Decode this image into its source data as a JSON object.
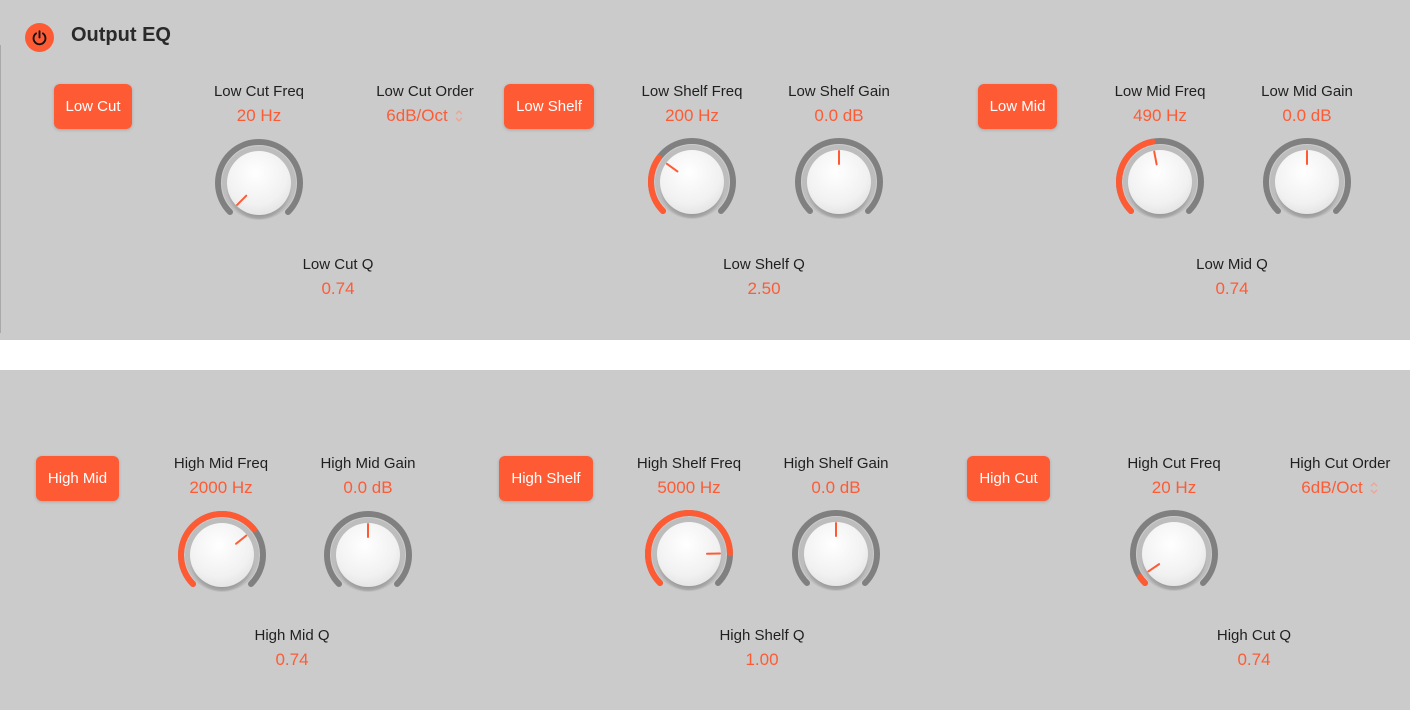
{
  "header": {
    "title": "Output EQ",
    "power_icon": "power-icon",
    "power_on": true
  },
  "colors": {
    "accent": "#fe5b35",
    "track": "#808080",
    "panel": "#cbcbcb",
    "label": "#1f1f1f"
  },
  "bands": {
    "low_cut": {
      "button": "Low Cut",
      "freq": {
        "label": "Low Cut Freq",
        "value": "20 Hz",
        "knob_fraction": 0.0
      },
      "order": {
        "label": "Low Cut Order",
        "value": "6dB/Oct",
        "icon": "up-down-chevron-icon"
      },
      "q": {
        "label": "Low Cut Q",
        "value": "0.74"
      }
    },
    "low_shelf": {
      "button": "Low Shelf",
      "freq": {
        "label": "Low Shelf Freq",
        "value": "200 Hz",
        "knob_fraction": 0.3
      },
      "gain": {
        "label": "Low Shelf Gain",
        "value": "0.0 dB",
        "knob_fraction": 0.5
      },
      "q": {
        "label": "Low Shelf Q",
        "value": "2.50"
      }
    },
    "low_mid": {
      "button": "Low Mid",
      "freq": {
        "label": "Low Mid Freq",
        "value": "490 Hz",
        "knob_fraction": 0.46
      },
      "gain": {
        "label": "Low Mid Gain",
        "value": "0.0 dB",
        "knob_fraction": 0.5
      },
      "q": {
        "label": "Low Mid Q",
        "value": "0.74"
      }
    },
    "high_mid": {
      "button": "High Mid",
      "freq": {
        "label": "High Mid Freq",
        "value": "2000 Hz",
        "knob_fraction": 0.69
      },
      "gain": {
        "label": "High Mid Gain",
        "value": "0.0 dB",
        "knob_fraction": 0.5
      },
      "q": {
        "label": "High Mid Q",
        "value": "0.74"
      }
    },
    "high_shelf": {
      "button": "High Shelf",
      "freq": {
        "label": "High Shelf Freq",
        "value": "5000 Hz",
        "knob_fraction": 0.83
      },
      "gain": {
        "label": "High Shelf Gain",
        "value": "0.0 dB",
        "knob_fraction": 0.5
      },
      "q": {
        "label": "High Shelf Q",
        "value": "1.00"
      }
    },
    "high_cut": {
      "button": "High Cut",
      "freq": {
        "label": "High Cut Freq",
        "value": "20 Hz",
        "knob_fraction": 0.04
      },
      "order": {
        "label": "High Cut Order",
        "value": "6dB/Oct",
        "icon": "up-down-chevron-icon"
      },
      "q": {
        "label": "High Cut Q",
        "value": "0.74"
      }
    }
  }
}
